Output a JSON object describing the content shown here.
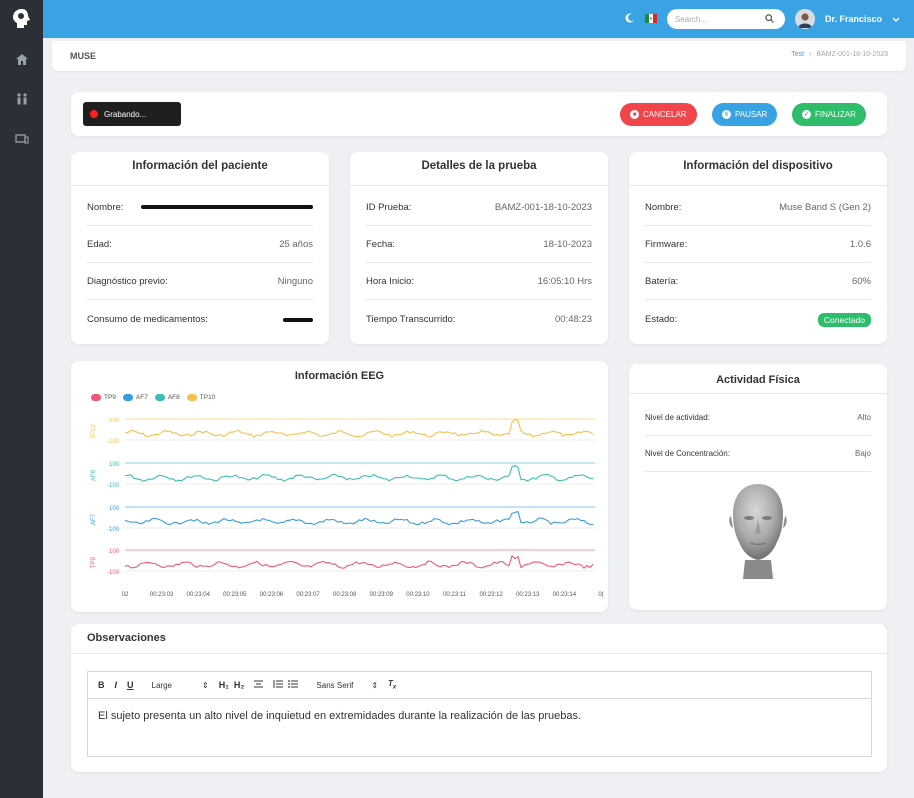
{
  "app": {
    "page_name": "MUSE",
    "breadcrumb": [
      "Test",
      "BAMZ-001-18-10-2023"
    ],
    "search_placeholder": "Search...",
    "user_name": "Dr. Francisco",
    "icons": [
      "brain-logo-icon",
      "home-icon",
      "people-icon",
      "devices-icon",
      "moon-icon",
      "mexico-flag-icon",
      "search-icon",
      "chevron-down-icon"
    ]
  },
  "session": {
    "recording_label": "Grabando...",
    "buttons": {
      "cancel": "CANCELAR",
      "pause": "PAUSAR",
      "finish": "FINALIZAR"
    },
    "colors": {
      "cancel": "#f0454a",
      "pause": "#37a3e2",
      "finish": "#2ebd6b"
    }
  },
  "patient": {
    "title": "Información del paciente",
    "rows": [
      {
        "label": "Nombre:",
        "value": ""
      },
      {
        "label": "Edad:",
        "value": "25 años"
      },
      {
        "label": "Diagnóstico previo:",
        "value": "Ninguno"
      },
      {
        "label": "Consumo de medicamentos:",
        "value": ""
      }
    ]
  },
  "test": {
    "title": "Detalles de la prueba",
    "rows": [
      {
        "label": "ID Prueba:",
        "value": "BAMZ-001-18-10-2023"
      },
      {
        "label": "Fecha:",
        "value": "18-10-2023"
      },
      {
        "label": "Hora Inicio:",
        "value": "16:05:10 Hrs"
      },
      {
        "label": "Tiempo Transcurrido:",
        "value": "00:48:23"
      }
    ]
  },
  "device": {
    "title": "Información del dispositivo",
    "rows": [
      {
        "label": "Nombre:",
        "value": "Muse Band S (Gen 2)"
      },
      {
        "label": "Firmware:",
        "value": "1.0.6"
      },
      {
        "label": "Batería:",
        "value": "60%"
      },
      {
        "label": "Estado:",
        "value": "Conectado"
      }
    ]
  },
  "eeg": {
    "title": "Información EEG",
    "legend": [
      {
        "name": "TP9",
        "color": "#f0577a"
      },
      {
        "name": "AF7",
        "color": "#3a9be0"
      },
      {
        "name": "AF8",
        "color": "#3dbdb8"
      },
      {
        "name": "TP10",
        "color": "#f5c14a"
      }
    ],
    "channels": [
      {
        "name": "TP10",
        "color": "#f5c14a",
        "tick_top": "100",
        "tick_bottom": "-100"
      },
      {
        "name": "AF8",
        "color": "#3dbdb8",
        "tick_top": "100",
        "tick_bottom": "-100"
      },
      {
        "name": "AF7",
        "color": "#3a9be0",
        "tick_top": "100",
        "tick_bottom": "-100"
      },
      {
        "name": "TP9",
        "color": "#f0577a",
        "tick_top": "100",
        "tick_bottom": "-100"
      }
    ],
    "x_ticks": [
      "02",
      "00:23:03",
      "00:23:04",
      "00:23:05",
      "00:23:06",
      "00:23:07",
      "00:23:08",
      "00:23:09",
      "00:23:10",
      "00:23:11",
      "00:23:12",
      "00:23:13",
      "00:23:14",
      "0("
    ]
  },
  "activity": {
    "title": "Actividad Física",
    "rows": [
      {
        "label": "Nivel de actividad:",
        "value": "Alto"
      },
      {
        "label": "Nivel de Concentración:",
        "value": "Bajo"
      }
    ]
  },
  "observations": {
    "title": "Observaciones",
    "toolbar": {
      "bold": "B",
      "italic": "I",
      "underline": "U",
      "size": "Large",
      "h1": "H₁",
      "h2": "H₂",
      "font": "Sans Serif"
    },
    "text": "El sujeto presenta un alto nivel de inquietud en extremidades durante la realización de las pruebas."
  }
}
